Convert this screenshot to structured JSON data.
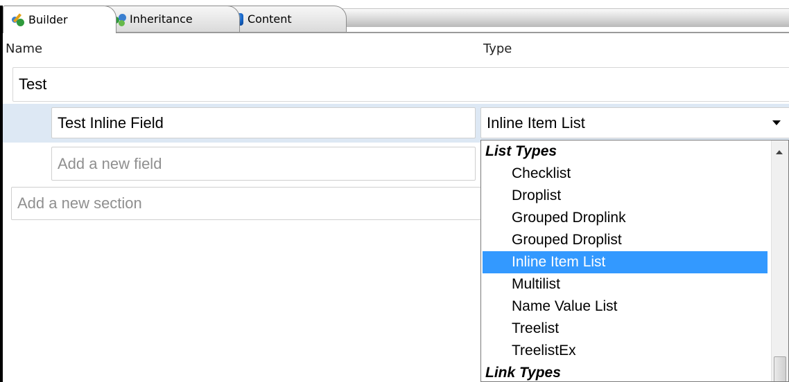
{
  "tabs": [
    {
      "label": "Builder",
      "icon": "builder-icon",
      "active": true
    },
    {
      "label": "Inheritance",
      "icon": "inheritance-icon",
      "active": false
    },
    {
      "label": "Content",
      "icon": "content-icon",
      "active": false
    }
  ],
  "columns": {
    "name": "Name",
    "type": "Type"
  },
  "section": {
    "name": "Test"
  },
  "field": {
    "name": "Test Inline Field",
    "type": "Inline Item List"
  },
  "new_field": {
    "placeholder": "Add a new field"
  },
  "new_section": {
    "placeholder": "Add a new section"
  },
  "dropdown": {
    "groups": [
      {
        "label": "List Types"
      },
      {
        "label": "Link Types"
      }
    ],
    "items": [
      "Checklist",
      "Droplist",
      "Grouped Droplink",
      "Grouped Droplist",
      "Inline Item List",
      "Multilist",
      "Name Value List",
      "Treelist",
      "TreelistEx"
    ],
    "selected": "Inline Item List"
  },
  "colors": {
    "selection": "#3399ff",
    "row_highlight": "#dde8f4"
  }
}
